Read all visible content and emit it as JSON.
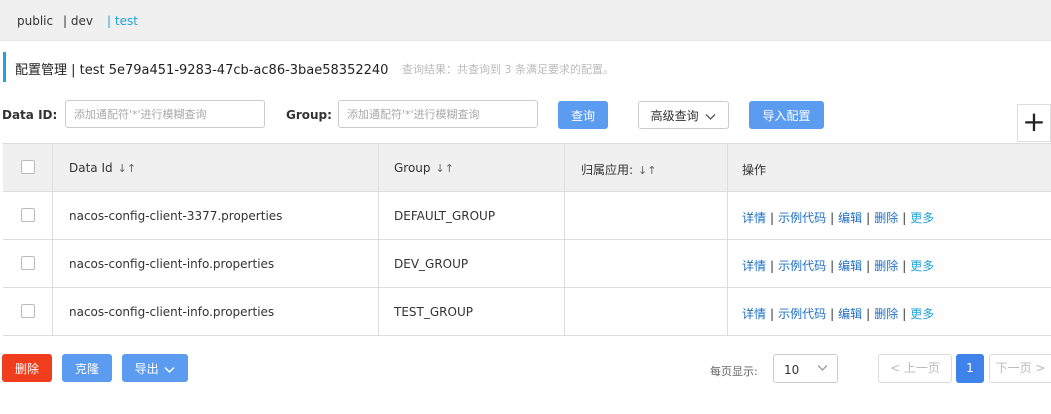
{
  "namespaces": {
    "public": "public",
    "dev": "| dev",
    "test": "| test"
  },
  "header": {
    "title": "配置管理  |  test  5e79a451-9283-47cb-ac86-3bae58352240",
    "hint": "查询结果：共查询到 3 条满足要求的配置。"
  },
  "search": {
    "data_id_label": "Data ID:",
    "data_id_placeholder": "添加通配符'*'进行模糊查询",
    "group_label": "Group:",
    "group_placeholder": "添加通配符'*'进行模糊查询",
    "query_label": "查询",
    "advanced_label": "高级查询",
    "import_label": "导入配置",
    "plus_symbol": "+"
  },
  "table": {
    "headers": {
      "data_id": "Data Id",
      "group": "Group",
      "app": "归属应用:",
      "ops": "操作"
    },
    "sort_symbol": "↓↑",
    "rows": [
      {
        "data_id": "nacos-config-client-3377.properties",
        "group": "DEFAULT_GROUP",
        "app": ""
      },
      {
        "data_id": "nacos-config-client-info.properties",
        "group": "DEV_GROUP",
        "app": ""
      },
      {
        "data_id": "nacos-config-client-info.properties",
        "group": "TEST_GROUP",
        "app": ""
      }
    ],
    "ops": {
      "detail": "详情",
      "sample": "示例代码",
      "edit": "编辑",
      "delete": "删除",
      "more": "更多",
      "sep": "|"
    }
  },
  "footer": {
    "delete_label": "删除",
    "clone_label": "克隆",
    "export_label": "导出",
    "page_size_label": "每页显示:",
    "page_size_value": "10",
    "prev_label": "< 上一页",
    "current_page": "1",
    "next_label": "下一页 >"
  },
  "colors": {
    "accent": "#1fa4d8",
    "primary": "#5b9bf0",
    "danger": "#ef3d1d",
    "link": "#1f6fc5"
  }
}
